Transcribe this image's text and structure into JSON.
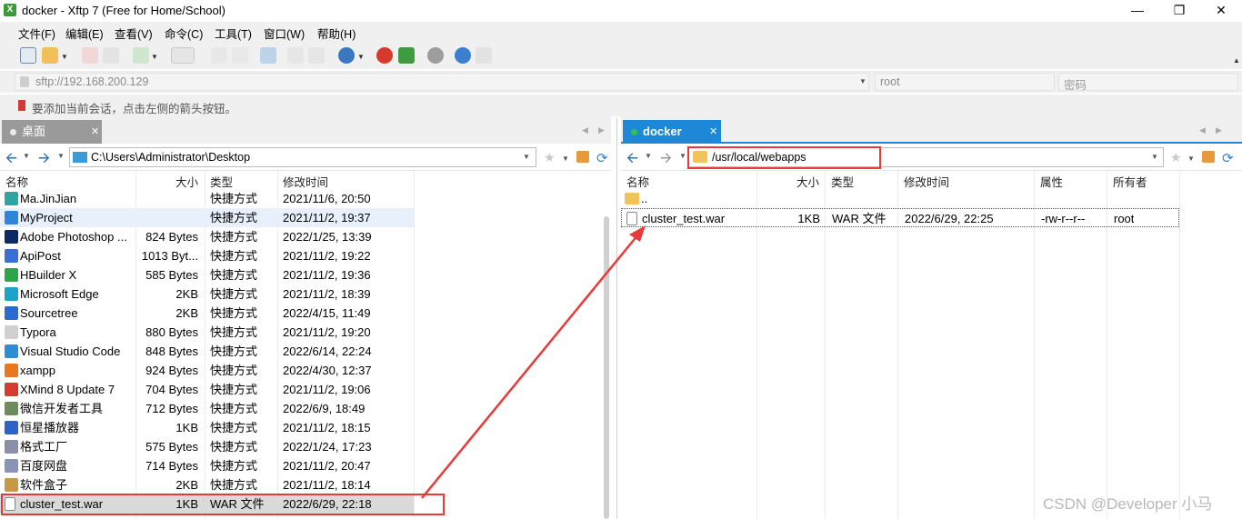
{
  "window": {
    "title": "docker - Xftp 7 (Free for Home/School)"
  },
  "menu": [
    "文件(F)",
    "编辑(E)",
    "查看(V)",
    "命令(C)",
    "工具(T)",
    "窗口(W)",
    "帮助(H)"
  ],
  "address": {
    "url": "sftp://192.168.200.129",
    "user": "root",
    "password_placeholder": "密码"
  },
  "hint": "要添加当前会话，点击左侧的箭头按钮。",
  "left": {
    "tab": "桌面",
    "path": "C:\\Users\\Administrator\\Desktop",
    "headers": {
      "name": "名称",
      "size": "大小",
      "type": "类型",
      "mtime": "修改时间"
    },
    "rows": [
      {
        "name": "Ma.JinJian",
        "size": "",
        "type": "快捷方式",
        "mtime": "2021/11/6, 20:50",
        "icon": "user-icon"
      },
      {
        "name": "MyProject",
        "size": "",
        "type": "快捷方式",
        "mtime": "2021/11/2, 19:37",
        "icon": "folder-shortcut-icon"
      },
      {
        "name": "Adobe Photoshop ...",
        "size": "824 Bytes",
        "type": "快捷方式",
        "mtime": "2022/1/25, 13:39",
        "icon": "photoshop-icon"
      },
      {
        "name": "ApiPost",
        "size": "1013 Byt...",
        "type": "快捷方式",
        "mtime": "2021/11/2, 19:22",
        "icon": "apipost-icon"
      },
      {
        "name": "HBuilder X",
        "size": "585 Bytes",
        "type": "快捷方式",
        "mtime": "2021/11/2, 19:36",
        "icon": "hbuilder-icon"
      },
      {
        "name": "Microsoft Edge",
        "size": "2KB",
        "type": "快捷方式",
        "mtime": "2021/11/2, 18:39",
        "icon": "edge-icon"
      },
      {
        "name": "Sourcetree",
        "size": "2KB",
        "type": "快捷方式",
        "mtime": "2022/4/15, 11:49",
        "icon": "sourcetree-icon"
      },
      {
        "name": "Typora",
        "size": "880 Bytes",
        "type": "快捷方式",
        "mtime": "2021/11/2, 19:20",
        "icon": "typora-icon"
      },
      {
        "name": "Visual Studio Code",
        "size": "848 Bytes",
        "type": "快捷方式",
        "mtime": "2022/6/14, 22:24",
        "icon": "vscode-icon"
      },
      {
        "name": "xampp",
        "size": "924 Bytes",
        "type": "快捷方式",
        "mtime": "2022/4/30, 12:37",
        "icon": "xampp-icon"
      },
      {
        "name": "XMind 8 Update 7",
        "size": "704 Bytes",
        "type": "快捷方式",
        "mtime": "2021/11/2, 19:06",
        "icon": "xmind-icon"
      },
      {
        "name": "微信开发者工具",
        "size": "712 Bytes",
        "type": "快捷方式",
        "mtime": "2022/6/9, 18:49",
        "icon": "wechat-devtools-icon"
      },
      {
        "name": "恒星播放器",
        "size": "1KB",
        "type": "快捷方式",
        "mtime": "2021/11/2, 18:15",
        "icon": "player-icon"
      },
      {
        "name": "格式工厂",
        "size": "575 Bytes",
        "type": "快捷方式",
        "mtime": "2022/1/24, 17:23",
        "icon": "formatfactory-icon"
      },
      {
        "name": "百度网盘",
        "size": "714 Bytes",
        "type": "快捷方式",
        "mtime": "2021/11/2, 20:47",
        "icon": "baidu-netdisk-icon"
      },
      {
        "name": "软件盒子",
        "size": "2KB",
        "type": "快捷方式",
        "mtime": "2021/11/2, 18:14",
        "icon": "software-box-icon"
      },
      {
        "name": "cluster_test.war",
        "size": "1KB",
        "type": "WAR 文件",
        "mtime": "2022/6/29, 22:18",
        "icon": "file-icon"
      }
    ]
  },
  "right": {
    "tab": "docker",
    "path": "/usr/local/webapps",
    "headers": {
      "name": "名称",
      "size": "大小",
      "type": "类型",
      "mtime": "修改时间",
      "attr": "属性",
      "owner": "所有者"
    },
    "parent": "..",
    "rows": [
      {
        "name": "cluster_test.war",
        "size": "1KB",
        "type": "WAR 文件",
        "mtime": "2022/6/29, 22:25",
        "attr": "-rw-r--r--",
        "owner": "root"
      }
    ]
  },
  "watermark": "CSDN @Developer 小马",
  "colors": {
    "tab_active_left": "#9a9a9a",
    "tab_active_right": "#1e88d8",
    "annotation": "#e83a3a"
  }
}
